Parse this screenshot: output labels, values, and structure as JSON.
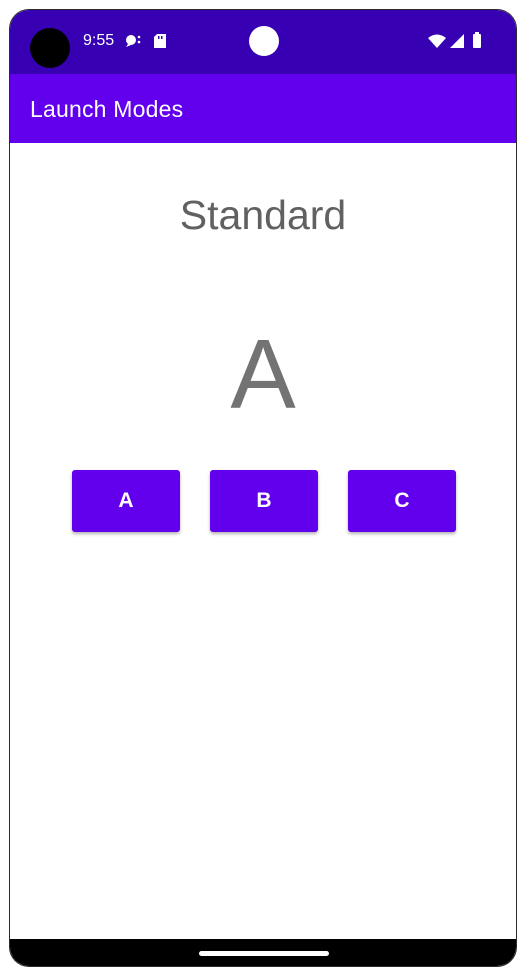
{
  "status_bar": {
    "time": "9:55",
    "icons": [
      "notification-icon",
      "sd-card-icon",
      "wifi-icon",
      "signal-icon",
      "battery-icon"
    ],
    "background_color": "#3700b3"
  },
  "app_bar": {
    "title": "Launch Modes",
    "background_color": "#6200ee"
  },
  "main": {
    "mode_label": "Standard",
    "current_activity": "A",
    "buttons": [
      {
        "label": "A"
      },
      {
        "label": "B"
      },
      {
        "label": "C"
      }
    ],
    "button_color": "#6200ee"
  },
  "navigation_bar": {
    "handle": "home-handle"
  }
}
